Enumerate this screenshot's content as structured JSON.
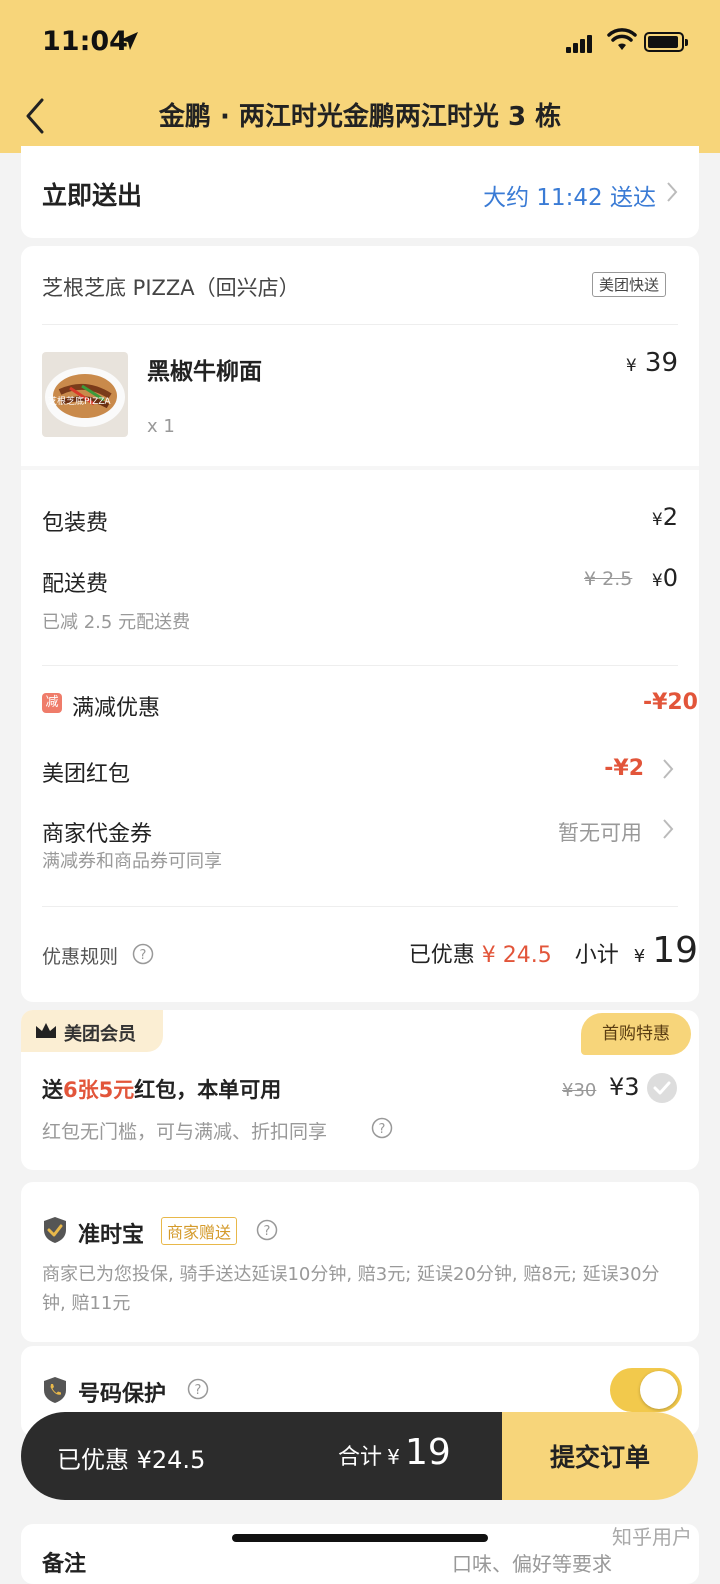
{
  "status_bar": {
    "time": "11:04"
  },
  "header": {
    "title": "金鹏 · 两江时光金鹏两江时光 3 栋"
  },
  "delivery": {
    "label": "立即送出",
    "eta": "大约 11:42 送达"
  },
  "store": {
    "name": "芝根芝底 PIZZA（回兴店）",
    "badge": "美团快送",
    "item": {
      "name": "黑椒牛柳面",
      "price": "39",
      "qty": "x 1",
      "image_text": "芝根芝底PIZZA"
    }
  },
  "fees": {
    "packaging_label": "包装费",
    "packaging_value": "2",
    "delivery_label": "配送费",
    "delivery_original": "¥ 2.5",
    "delivery_value": "0",
    "delivery_note": "已减 2.5 元配送费"
  },
  "discounts": {
    "manjian_tag": "减",
    "manjian_label": "满减优惠",
    "manjian_value": "-¥20",
    "redpacket_label": "美团红包",
    "redpacket_value": "-¥2",
    "voucher_label": "商家代金券",
    "voucher_value": "暂无可用",
    "voucher_note": "满减券和商品券可同享",
    "rules_label": "优惠规则",
    "saved_label": "已优惠",
    "saved_value": "¥ 24.5",
    "subtotal_label": "小计",
    "subtotal_value": "19"
  },
  "member": {
    "tag": "美团会员",
    "first_tag": "首购特惠",
    "offer_prefix": "送",
    "offer_highlight": "6张5元",
    "offer_suffix": "红包，本单可用",
    "original_price": "¥30",
    "price": "¥3",
    "note": "红包无门槛，可与满减、折扣同享"
  },
  "ontime": {
    "title": "准时宝",
    "badge": "商家赠送",
    "desc": "商家已为您投保, 骑手送达延误10分钟, 赔3元; 延误20分钟, 赔8元; 延误30分钟, 赔11元"
  },
  "privacy": {
    "title": "号码保护",
    "enabled": true
  },
  "remark": {
    "label": "备注",
    "value": "口味、偏好等要求"
  },
  "bottom_bar": {
    "saved": "已优惠 ¥24.5",
    "total_label": "合计",
    "total_currency": "¥",
    "total_value": "19",
    "submit": "提交订单"
  },
  "watermark": "知乎用户"
}
